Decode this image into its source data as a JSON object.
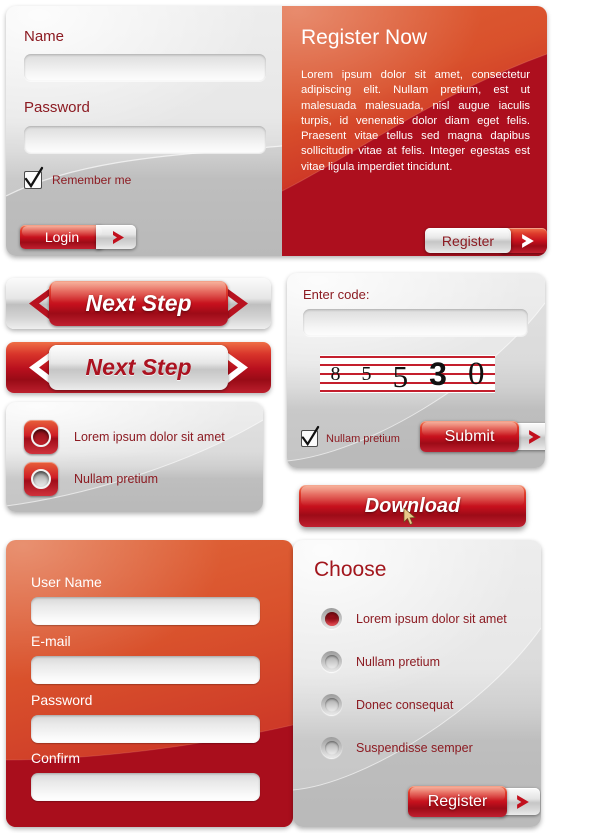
{
  "login_panel": {
    "name_label": "Name",
    "name_value": "",
    "name_placeholder": "",
    "password_label": "Password",
    "password_value": "",
    "password_placeholder": "",
    "remember_label": "Remember  me",
    "remember_checked": true,
    "login_button": "Login",
    "register_title": "Register Now",
    "register_body": "Lorem ipsum dolor sit amet, consectetur adipiscing elit. Nullam pretium, est ut malesuada malesuada, nisl augue iaculis turpis, id venenatis dolor diam eget felis. Praesent vitae tellus sed magna dapibus sollicitudin vitae at felis. Integer egestas est vitae ligula imperdiet tincidunt.",
    "register_button": "Register"
  },
  "next_step_red": {
    "label": "Next Step"
  },
  "next_step_gray": {
    "label": "Next Step"
  },
  "square_radio_panel": {
    "options": [
      {
        "label": "Lorem ipsum dolor sit amet",
        "selected": true
      },
      {
        "label": "Nullam pretium",
        "selected": false
      }
    ]
  },
  "captcha_panel": {
    "enter_code_label": "Enter code:",
    "code_value": "",
    "code_placeholder": "",
    "captcha_text": "85530",
    "captcha_digits": [
      "8",
      "5",
      "5",
      "3",
      "0"
    ],
    "checkbox_label": "Nullam pretium",
    "checkbox_checked": true,
    "submit_button": "Submit"
  },
  "download_button": {
    "label": "Download"
  },
  "register_form": {
    "fields": [
      {
        "label": "User Name",
        "value": "",
        "placeholder": ""
      },
      {
        "label": "E-mail",
        "value": "",
        "placeholder": ""
      },
      {
        "label": "Password",
        "value": "",
        "placeholder": ""
      },
      {
        "label": "Confirm",
        "value": "",
        "placeholder": ""
      }
    ]
  },
  "choose_panel": {
    "title": "Choose",
    "options": [
      {
        "label": "Lorem ipsum dolor sit amet",
        "selected": true
      },
      {
        "label": "Nullam pretium",
        "selected": false
      },
      {
        "label": "Donec consequat",
        "selected": false
      },
      {
        "label": "Suspendisse semper",
        "selected": false
      }
    ],
    "register_button": "Register"
  },
  "colors": {
    "accent_red": "#c5101d",
    "accent_orange": "#d9512c",
    "dark_red": "#a50d1c",
    "text_dark_red": "#8c1b22",
    "panel_gray_light": "#ededed",
    "panel_gray_dark": "#c4c4c4",
    "captcha_line": "#c41f2d"
  }
}
